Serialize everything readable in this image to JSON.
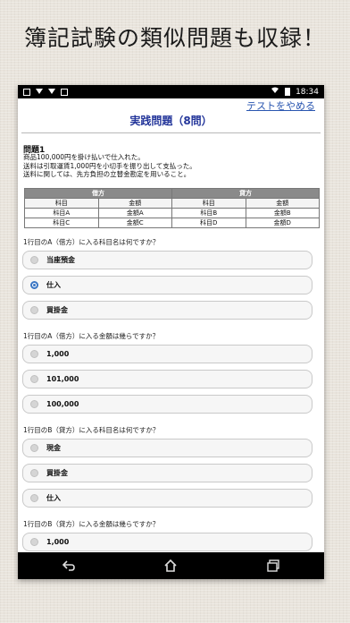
{
  "banner": {
    "headline": "簿記試験の類似問題も収録！"
  },
  "status_bar": {
    "time": "18:34"
  },
  "header": {
    "quit_link": "テストをやめる",
    "title": "実践問題（8問）"
  },
  "problem": {
    "heading": "問題1",
    "lines": [
      "商品100,000円を掛け払いで仕入れた。",
      "送料は引取運賃1,000円を小切手を振り出して支払った。",
      "送料に関しては、先方負担の立替金勘定を用いること。"
    ]
  },
  "ledger": {
    "debit_header": "借方",
    "credit_header": "貸方",
    "col_headers": [
      "科目",
      "金額",
      "科目",
      "金額"
    ],
    "rows": [
      [
        "科目A",
        "金額A",
        "科目B",
        "金額B"
      ],
      [
        "科目C",
        "金額C",
        "科目D",
        "金額D"
      ]
    ]
  },
  "questions": [
    {
      "label": "1行目のA（借方）に入る科目名は何ですか？",
      "options": [
        "当座預金",
        "仕入",
        "買掛金"
      ],
      "selected": 1
    },
    {
      "label": "1行目のA（借方）に入る金額は幾らですか？",
      "options": [
        "1,000",
        "101,000",
        "100,000"
      ],
      "selected": null
    },
    {
      "label": "1行目のB（貸方）に入る科目名は何ですか？",
      "options": [
        "現金",
        "買掛金",
        "仕入"
      ],
      "selected": null
    },
    {
      "label": "1行目のB（貸方）に入る金額は幾らですか？",
      "options": [
        "1,000"
      ],
      "selected": null
    }
  ],
  "nav": {
    "icons": [
      "back-icon",
      "home-icon",
      "recents-icon"
    ]
  },
  "colors": {
    "accent": "#3a76c3",
    "title": "#23359a",
    "link": "#2a56b0"
  }
}
